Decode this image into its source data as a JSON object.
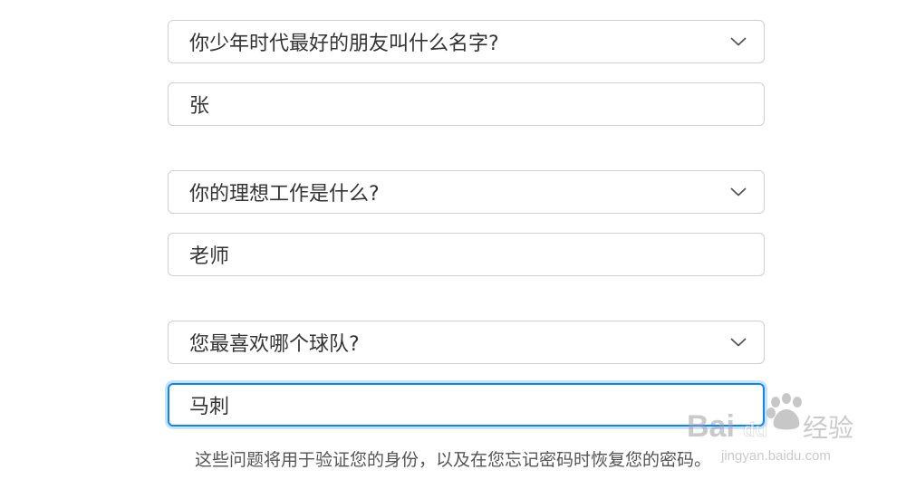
{
  "security_questions": [
    {
      "question": "你少年时代最好的朋友叫什么名字?",
      "answer": "张"
    },
    {
      "question": "你的理想工作是什么?",
      "answer": "老师"
    },
    {
      "question": "您最喜欢哪个球队?",
      "answer": "马刺"
    }
  ],
  "footnote": "这些问题将用于验证您的身份，以及在您忘记密码时恢复您的密码。",
  "watermark": {
    "brand": "Baidu",
    "brand_cn": "经验",
    "url": "jingyan.baidu.com"
  },
  "colors": {
    "focus": "#0a84ff",
    "border": "#cfcfcf",
    "text": "#333333"
  },
  "icons": {
    "dropdown": "chevron-down-icon"
  }
}
